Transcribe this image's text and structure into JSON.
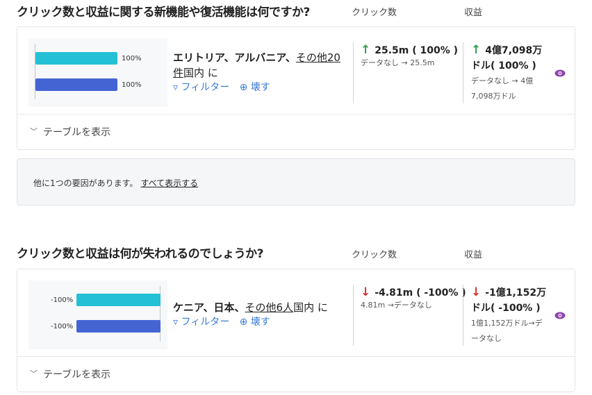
{
  "section1": {
    "title": "クリック数と収益に関する新機能や復活機能は何ですか?",
    "col_clicks": "クリック数",
    "col_revenue": "収益",
    "card": {
      "bars": [
        {
          "value_label": "100%",
          "color": "#23c0d6"
        },
        {
          "value_label": "100%",
          "color": "#4464d4"
        }
      ],
      "desc_bold": "エリトリア、アルバニア、",
      "desc_link": "その他20件",
      "desc_suffix": "国内 に",
      "filter_label": "▿ フィルター",
      "break_label": "⊕ 壊す",
      "clicks_main": "25.5m ( 100% )",
      "clicks_sub": "データなし → 25.5m",
      "revenue_main_1": "4億7,098万",
      "revenue_main_2": "ドル( 100% )",
      "revenue_sub_1": "データなし → 4億",
      "revenue_sub_2": "7,098万ドル",
      "direction": "up"
    },
    "footer_label": "テーブルを表示"
  },
  "note": {
    "text": "他に1つの要因があります。",
    "link": "すべて表示する"
  },
  "section2": {
    "title": "クリック数と収益は何が失われるのでしょうか?",
    "col_clicks": "クリック数",
    "col_revenue": "収益",
    "card": {
      "bars": [
        {
          "value_label": "-100%",
          "color": "#23c0d6"
        },
        {
          "value_label": "-100%",
          "color": "#4464d4"
        }
      ],
      "desc_bold": "ケニア、日本、",
      "desc_link": "その他6人",
      "desc_suffix": "国内 に",
      "filter_label": "▿ フィルター",
      "break_label": "⊕ 壊す",
      "clicks_main": "-4.81m ( -100% )",
      "clicks_sub": "4.81m →データなし",
      "revenue_main_1": "-1億1,152万",
      "revenue_main_2": "ドル( -100% )",
      "revenue_sub_1": "1億1,152万ドル→デ",
      "revenue_sub_2": "ータなし",
      "direction": "down"
    },
    "footer_label": "テーブルを表示"
  },
  "colors": {
    "up": "#2e9e4f",
    "down": "#d93030",
    "eye": "#8e44ad",
    "action": "#3a7bd5"
  }
}
